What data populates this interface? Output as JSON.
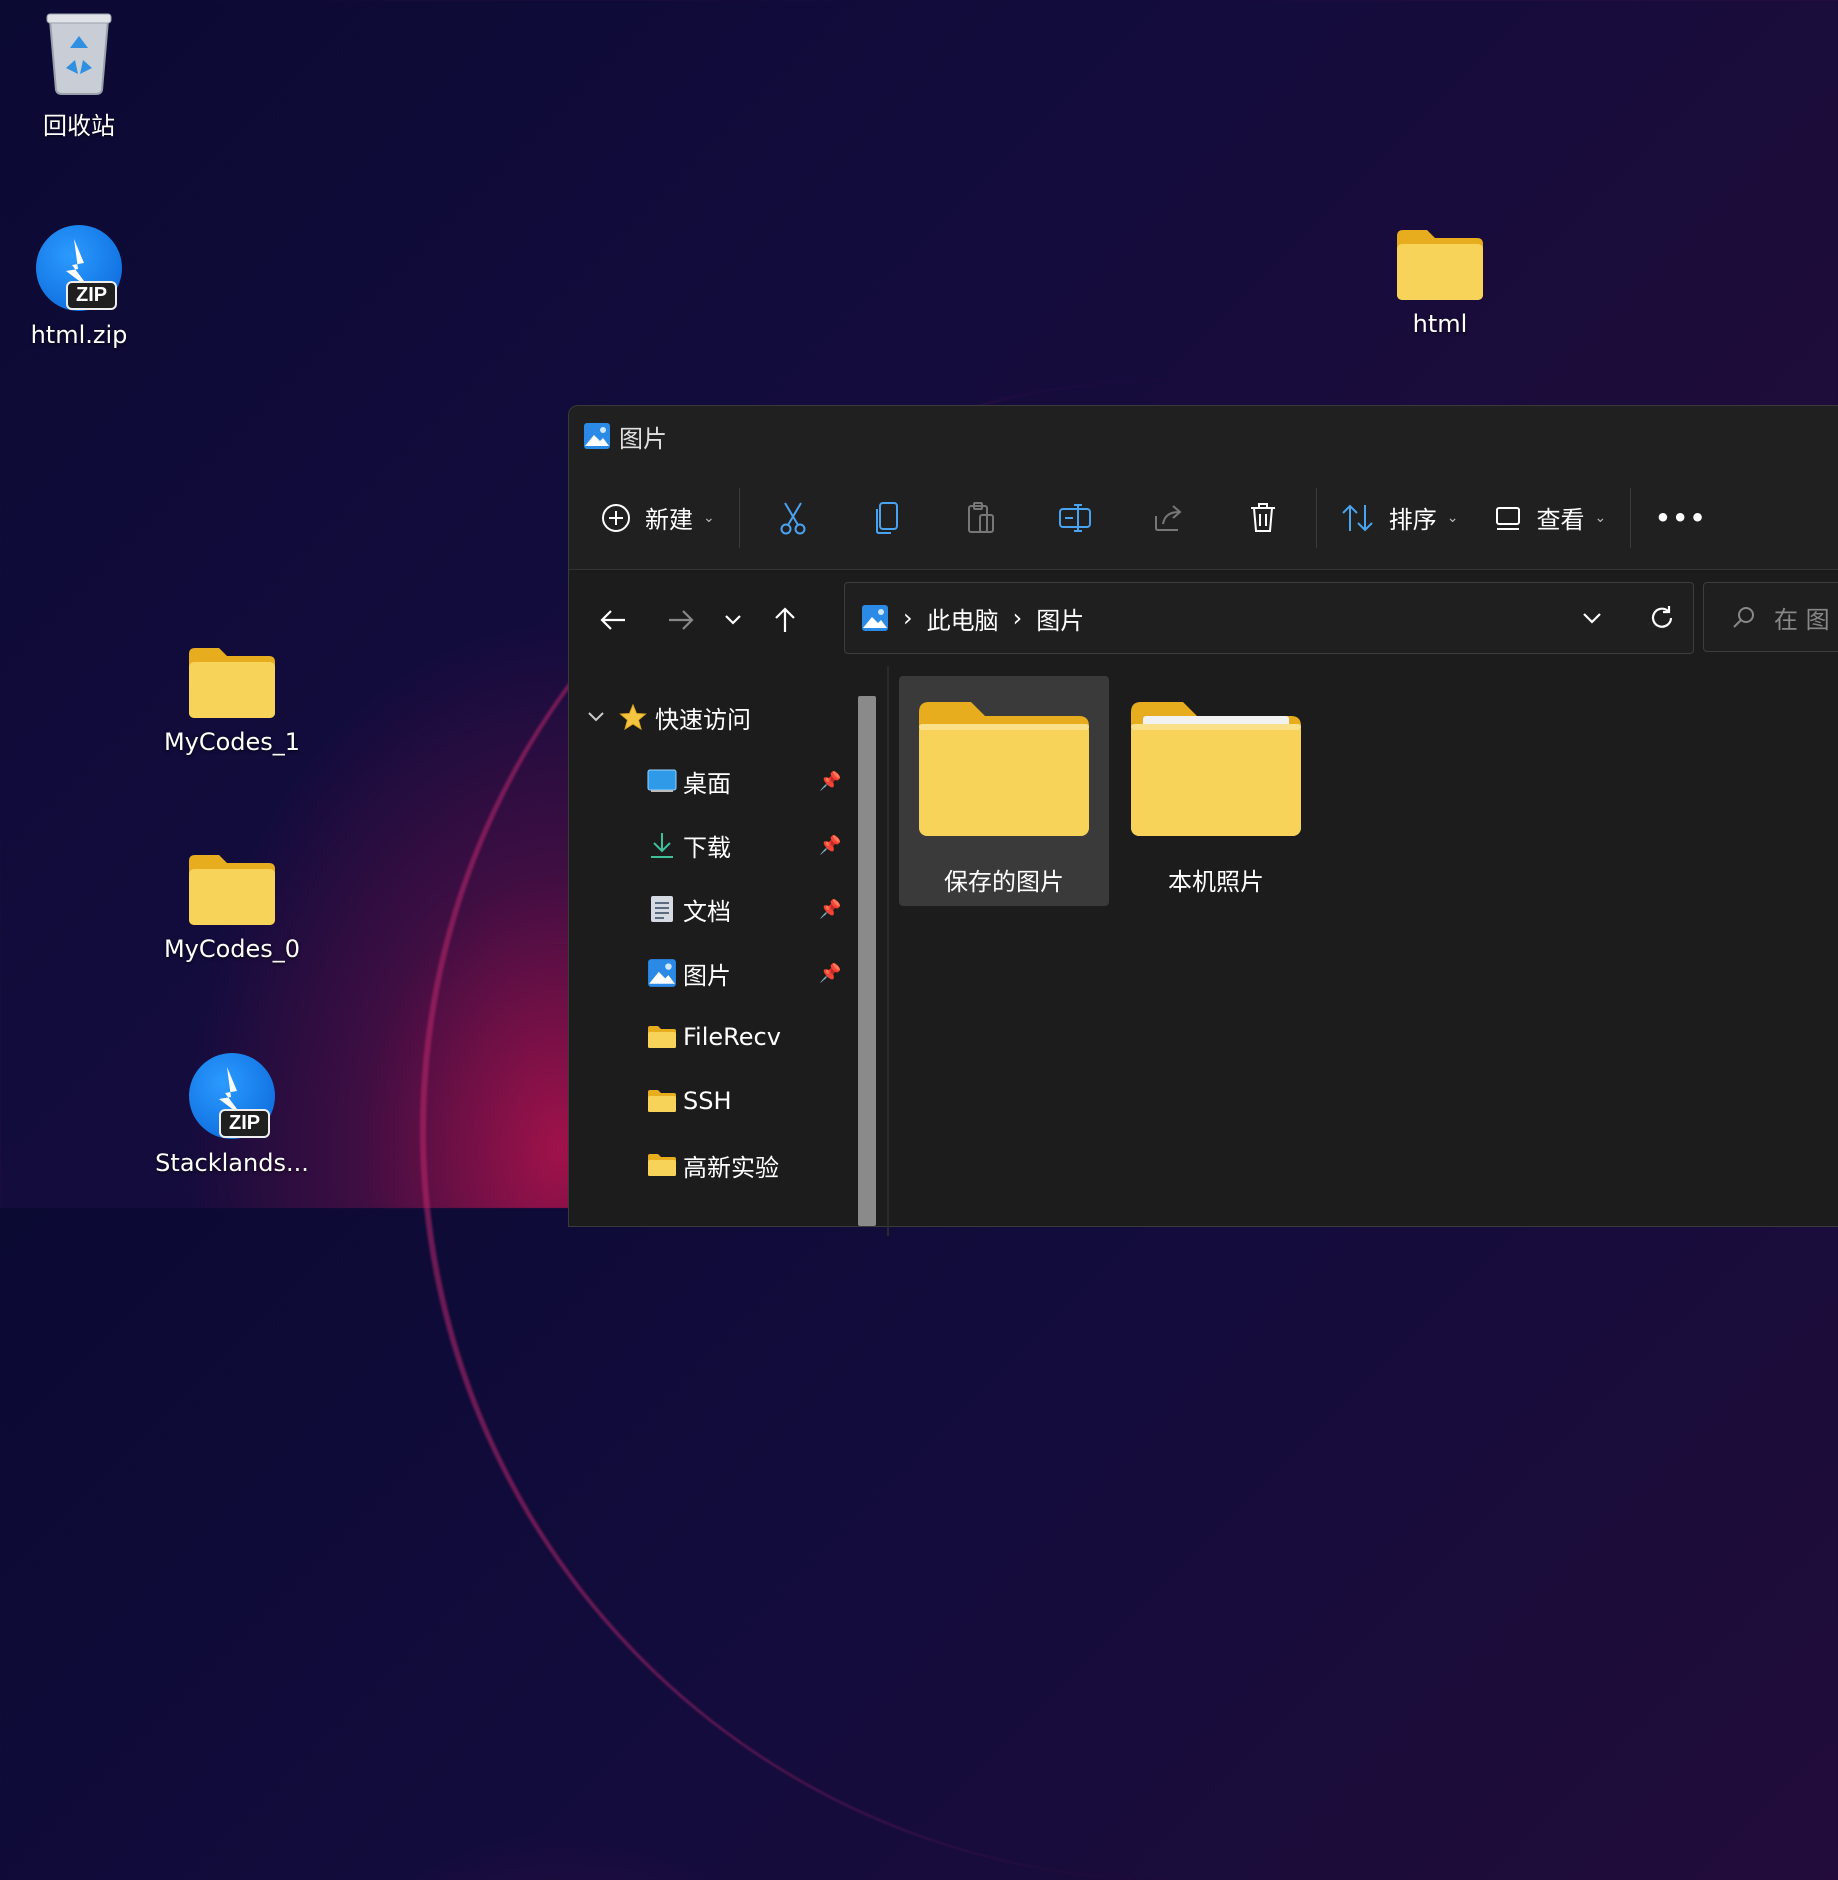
{
  "desktop": {
    "icons": [
      {
        "label": "回收站",
        "type": "recycle-bin"
      },
      {
        "label": "html.zip",
        "type": "zip"
      },
      {
        "label": "html",
        "type": "folder"
      },
      {
        "label": "MyCodes_1",
        "type": "folder"
      },
      {
        "label": "MyCodes_0",
        "type": "folder"
      },
      {
        "label": "Stacklands...",
        "type": "zip"
      }
    ],
    "zip_tag": "ZIP"
  },
  "explorer": {
    "title": "图片",
    "toolbar": {
      "new_label": "新建",
      "sort_label": "排序",
      "view_label": "查看",
      "more_label": "•••"
    },
    "address": {
      "segments": [
        "此电脑",
        "图片"
      ],
      "separator": "›"
    },
    "search": {
      "placeholder": "在 图"
    },
    "sidebar": {
      "quick_access": "快速访问",
      "items": [
        {
          "label": "桌面",
          "icon": "desktop-icon",
          "pinned": true
        },
        {
          "label": "下载",
          "icon": "download-icon",
          "pinned": true
        },
        {
          "label": "文档",
          "icon": "document-icon",
          "pinned": true
        },
        {
          "label": "图片",
          "icon": "pictures-icon",
          "pinned": true
        },
        {
          "label": "FileRecv",
          "icon": "folder-icon",
          "pinned": false
        },
        {
          "label": "SSH",
          "icon": "folder-icon",
          "pinned": false
        },
        {
          "label": "高新实验",
          "icon": "folder-icon",
          "pinned": false
        }
      ]
    },
    "files": [
      {
        "label": "保存的图片",
        "selected": true
      },
      {
        "label": "本机照片",
        "selected": false
      }
    ]
  },
  "colors": {
    "folder": "#f6c844",
    "folder_dark": "#e8ad1f",
    "accent": "#0a78d7",
    "window_bg": "#1c1c1c"
  }
}
